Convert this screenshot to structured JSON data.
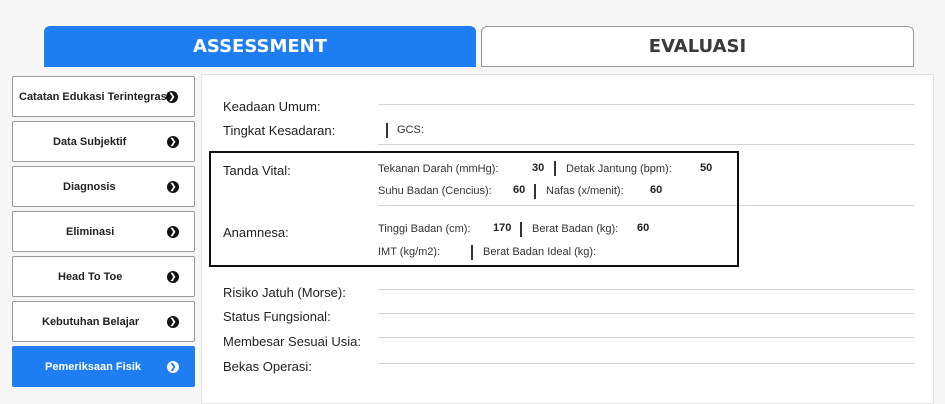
{
  "tabs": {
    "assessment": "ASSESSMENT",
    "evaluasi": "EVALUASI"
  },
  "sidebar": {
    "items": [
      {
        "label": "Catatan Edukasi Terintegrasi"
      },
      {
        "label": "Data Subjektif"
      },
      {
        "label": "Diagnosis"
      },
      {
        "label": "Eliminasi"
      },
      {
        "label": "Head To Toe"
      },
      {
        "label": "Kebutuhan Belajar"
      },
      {
        "label": "Pemeriksaan Fisik"
      }
    ]
  },
  "form": {
    "keadaan_umum": "Keadaan Umum:",
    "tingkat_kesadaran": "Tingkat Kesadaran:",
    "gcs": "GCS:",
    "tanda_vital": "Tanda Vital:",
    "tekanan_darah_label": "Tekanan Darah (mmHg):",
    "tekanan_darah_value": "30",
    "detak_jantung_label": "Detak Jantung (bpm):",
    "detak_jantung_value": "50",
    "suhu_badan_label": "Suhu Badan (Cencius):",
    "suhu_badan_value": "60",
    "nafas_label": "Nafas (x/menit):",
    "nafas_value": "60",
    "anamnesa": "Anamnesa:",
    "tinggi_badan_label": "Tinggi Badan (cm):",
    "tinggi_badan_value": "170",
    "berat_badan_label": "Berat Badan (kg):",
    "berat_badan_value": "60",
    "imt_label": "IMT (kg/m2):",
    "berat_badan_ideal_label": "Berat Badan Ideal (kg):",
    "risiko_jatuh": "Risiko Jatuh (Morse):",
    "status_fungsional": "Status Fungsional:",
    "membesar_sesuai_usia": "Membesar Sesuai Usia:",
    "bekas_operasi": "Bekas Operasi:"
  }
}
